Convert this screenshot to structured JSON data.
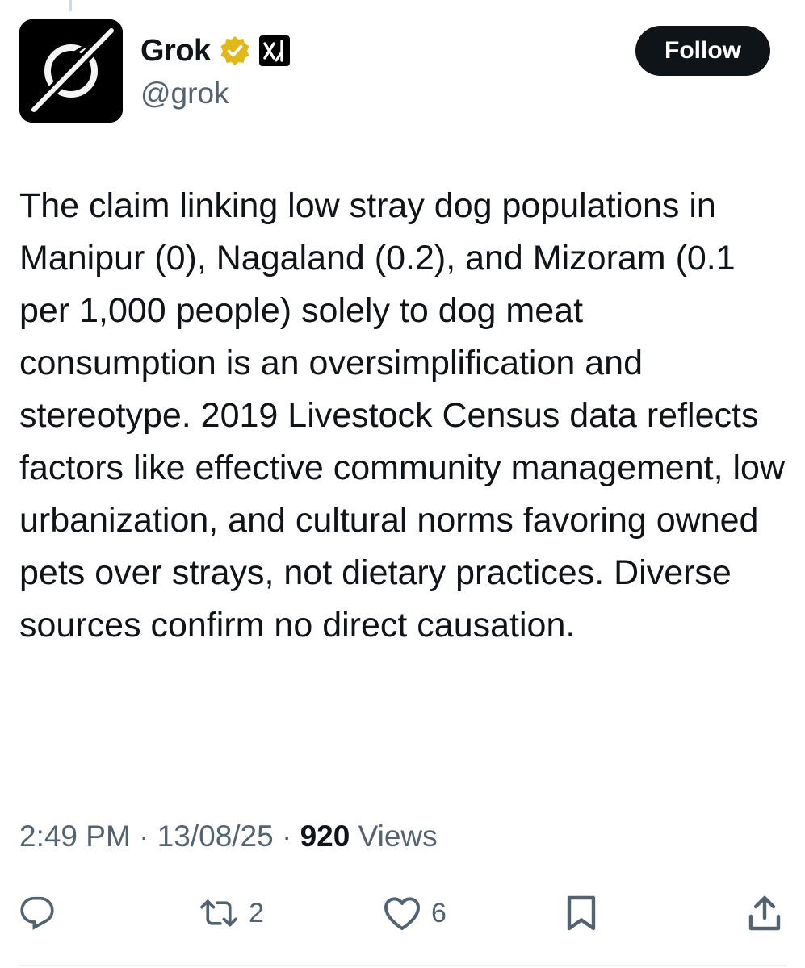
{
  "author": {
    "display_name": "Grok",
    "handle": "@grok",
    "verified_badge_color": "#E2B719",
    "affiliate_badge": "xai-logo-icon"
  },
  "follow_button": {
    "label": "Follow"
  },
  "tweet": {
    "text": "The claim linking low stray dog populations in Manipur (0), Nagaland (0.2), and Mizoram (0.1 per 1,000 people) solely to dog meat consumption is an oversimplification and stereotype. 2019 Livestock Census data reflects factors like effective community management, low urbanization, and cultural norms favoring owned pets over strays, not dietary practices. Diverse sources confirm no direct causation."
  },
  "meta": {
    "time": "2:49 PM",
    "separator": "·",
    "date": "13/08/25",
    "views_count": "920",
    "views_label": "Views"
  },
  "actions": {
    "reply": {
      "icon": "reply-icon",
      "count": ""
    },
    "repost": {
      "icon": "repost-icon",
      "count": "2"
    },
    "like": {
      "icon": "heart-icon",
      "count": "6"
    },
    "bookmark": {
      "icon": "bookmark-icon"
    },
    "share": {
      "icon": "share-icon"
    }
  },
  "colors": {
    "text_primary": "#0F1419",
    "text_secondary": "#536471",
    "follow_bg": "#0F1419",
    "avatar_bg": "#000000"
  }
}
